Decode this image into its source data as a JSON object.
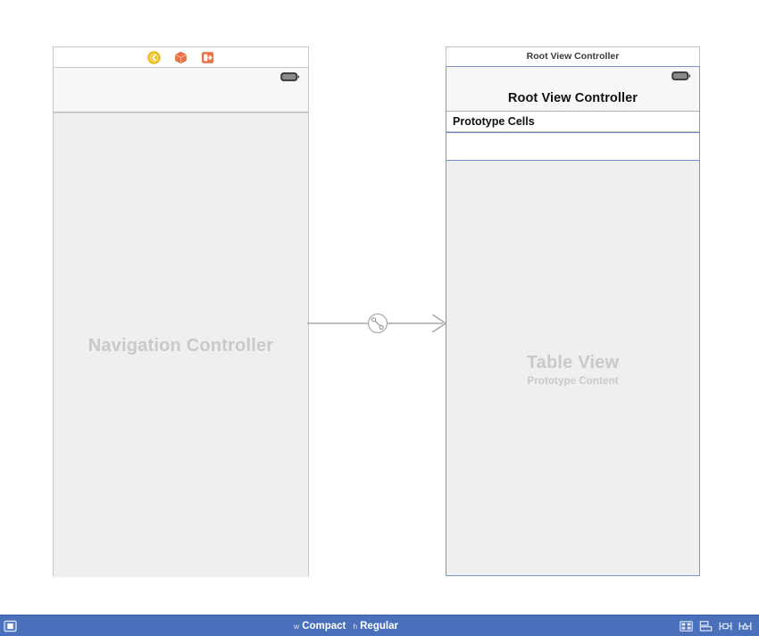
{
  "window": {
    "background": "#ffffff",
    "canvas_background": "#ffffff"
  },
  "scenes": [
    {
      "id": "navigation-controller",
      "dock_icons": [
        {
          "name": "view-controller-icon",
          "color": "#f5c518",
          "glyph": "chevron-left"
        },
        {
          "name": "first-responder-icon",
          "color": "#ef6a3c",
          "glyph": "cube"
        },
        {
          "name": "exit-icon",
          "color": "#ef6a3c",
          "glyph": "exit-arrow"
        }
      ],
      "status_bar": {
        "battery_icon": "battery-icon"
      },
      "nav_bar": {
        "title": ""
      },
      "placeholder": {
        "title": "Navigation Controller",
        "subtitle": ""
      }
    },
    {
      "id": "root-view-controller",
      "scene_title": "Root View Controller",
      "status_bar": {
        "battery_icon": "battery-icon"
      },
      "nav_bar": {
        "title": "Root View Controller"
      },
      "table_header": {
        "label": "Prototype Cells"
      },
      "prototype_cells": [
        {
          "label": ""
        }
      ],
      "placeholder": {
        "title": "Table View",
        "subtitle": "Prototype Content"
      }
    }
  ],
  "segue": {
    "name": "relationship-segue",
    "badge_icon": "relationship-icon",
    "stroke": "#a8a8a8",
    "direction": "left-to-right"
  },
  "bottom_bar": {
    "background": "#4a6fbb",
    "left_button": {
      "name": "document-outline-toggle",
      "icon": "panel-left-icon"
    },
    "size_class": {
      "width_prefix": "w",
      "width_value": "Compact",
      "height_prefix": "h",
      "height_value": "Regular"
    },
    "right_buttons": [
      {
        "name": "stack-view-button",
        "icon": "stack-view-icon"
      },
      {
        "name": "align-button",
        "icon": "align-icon"
      },
      {
        "name": "pin-button",
        "icon": "pin-icon"
      },
      {
        "name": "resolve-issues-button",
        "icon": "resolve-icon"
      }
    ]
  }
}
